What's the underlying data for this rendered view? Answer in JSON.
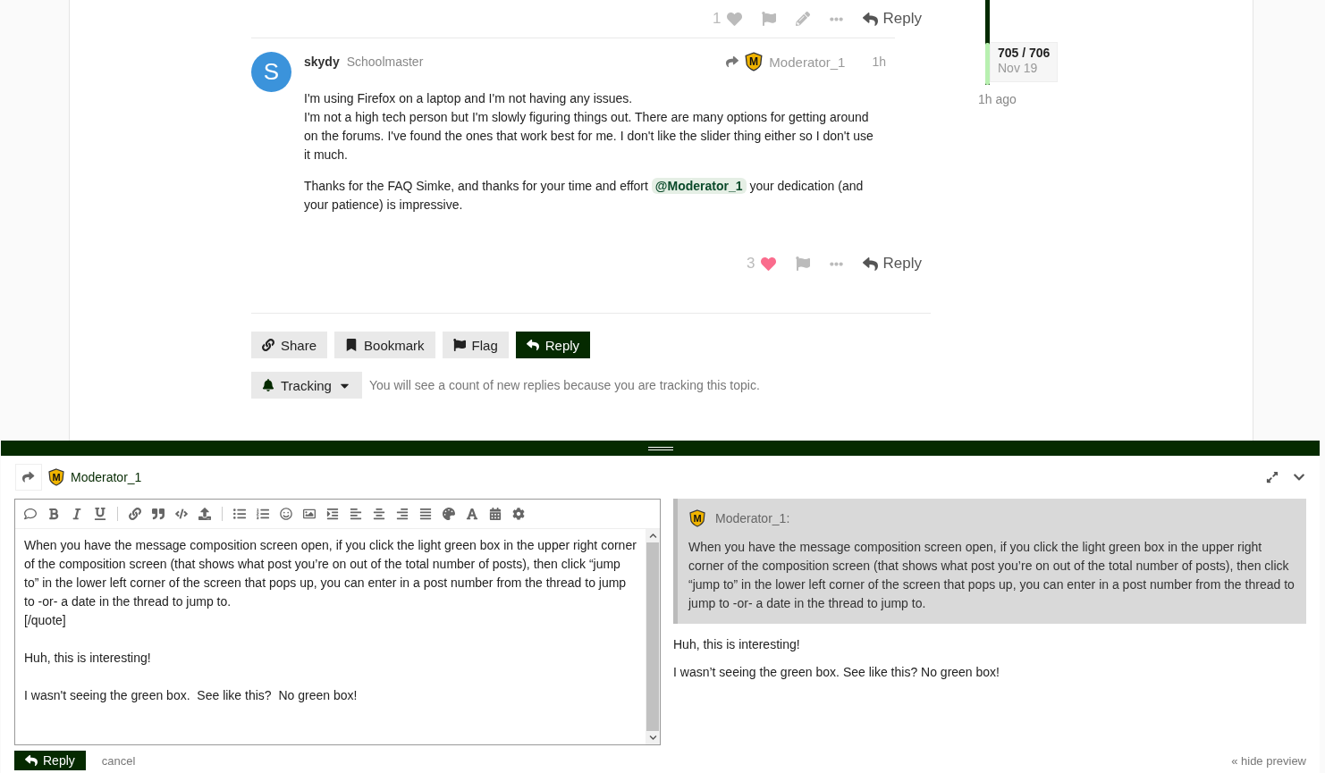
{
  "prev_post_actions": {
    "likes": "1",
    "liked": false,
    "reply": "Reply"
  },
  "post": {
    "avatar": "S",
    "username": "skydy",
    "title": "Schoolmaster",
    "reply_to": {
      "badge": "M",
      "name": "Moderator_1"
    },
    "time": "1h",
    "paragraphs": [
      "I'm using Firefox on a laptop and I'm not having any issues.\nI'm not a high tech person but I'm slowly figuring things out. There are many options for getting around on the forums. I've found the ones that work best for me. I don't like the slider thing either so I don't use it much."
    ],
    "last_paragraph": {
      "before": "Thanks for the FAQ Simke, and thanks for your time and effort ",
      "mention": "@Moderator_1",
      "after": " your dedication (and your patience) is impressive."
    },
    "likes": "3",
    "liked": true,
    "reply": "Reply"
  },
  "topic_buttons": [
    {
      "kind": "share",
      "label": "Share"
    },
    {
      "kind": "bookmark",
      "label": "Bookmark"
    },
    {
      "kind": "flag",
      "label": "Flag"
    },
    {
      "kind": "reply",
      "label": "Reply"
    }
  ],
  "tracking": {
    "label": "Tracking",
    "description": "You will see a count of new replies because you are tracking this topic."
  },
  "timeline": {
    "position": "705 / 706",
    "date": "Nov 19",
    "ago": "1h ago",
    "level": 0.5
  },
  "composer": {
    "reply_to": {
      "badge": "M",
      "name": "Moderator_1"
    },
    "value": "When you have the message composition screen open, if you click the light green box in the upper right corner of the composition screen (that shows what post you’re on out of the total number of posts), then click “jump to” in the lower left corner of the screen that pops up, you can enter in a post number from the thread to jump to -or- a date in the thread to jump to.\n[/quote]\n\nHuh, this is interesting!\n\nI wasn't seeing the green box.  See like this?  No green box!",
    "preview": {
      "quote": {
        "badge": "M",
        "author": "Moderator_1:",
        "text": "When you have the message composition screen open, if you click the light green box in the upper right corner of the composition screen (that shows what post you’re on out of the total number of posts), then click “jump to” in the lower left corner of the screen that pops up, you can enter in a post number from the thread to jump to -or- a date in the thread to jump to."
      },
      "paragraphs": [
        "Huh, this is interesting!",
        "I wasn’t seeing the green box. See like this? No green box!"
      ]
    },
    "submit": "Reply",
    "cancel": "cancel",
    "hide_preview": "« hide preview"
  }
}
